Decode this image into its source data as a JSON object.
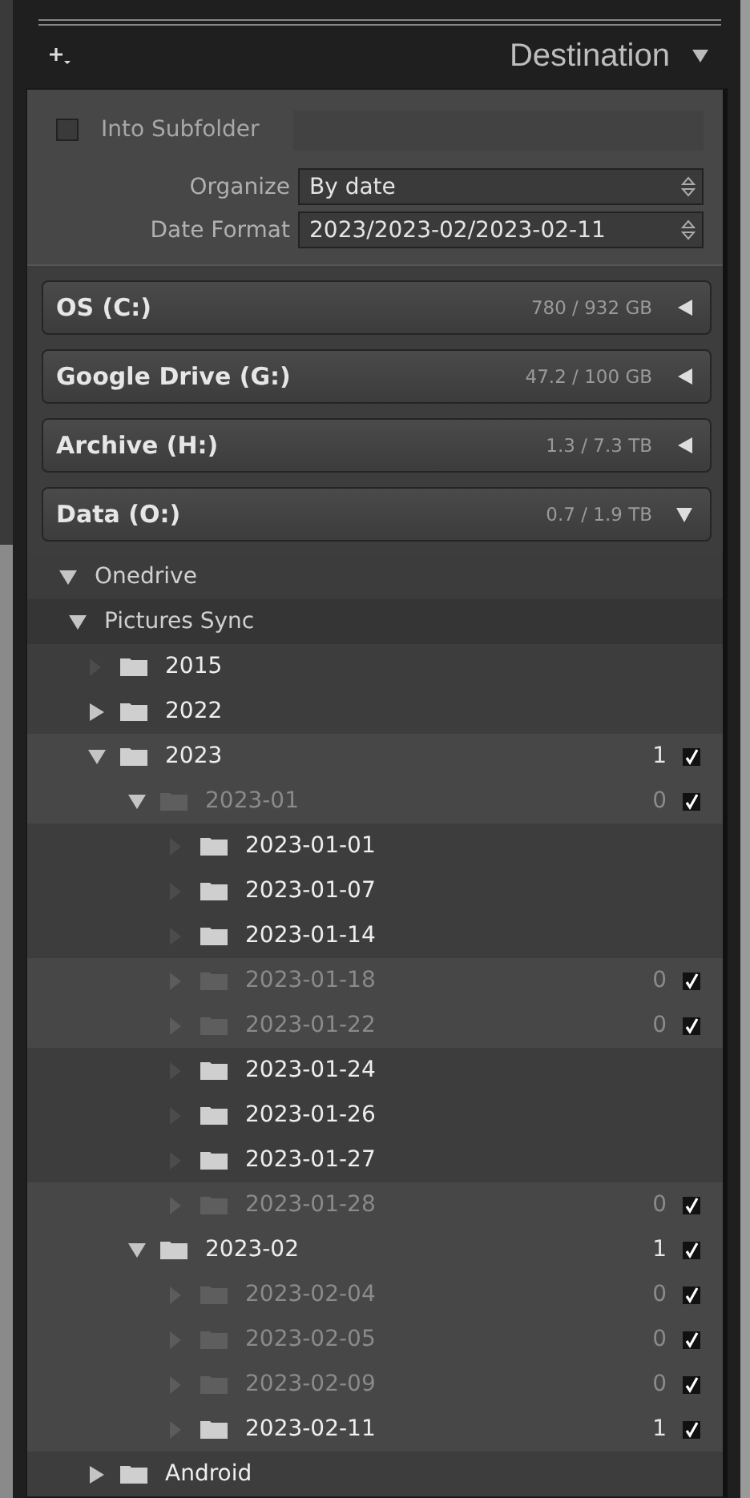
{
  "panel": {
    "title": "Destination",
    "expanded": true
  },
  "subfolder": {
    "label": "Into Subfolder",
    "checked": false
  },
  "organize": {
    "label": "Organize",
    "value": "By date"
  },
  "date_format": {
    "label": "Date Format",
    "value": "2023/2023-02/2023-02-11"
  },
  "drives": [
    {
      "name": "OS (C:)",
      "usage": "780 / 932 GB",
      "expanded": false
    },
    {
      "name": "Google Drive (G:)",
      "usage": "47.2 / 100 GB",
      "expanded": false
    },
    {
      "name": "Archive (H:)",
      "usage": "1.3 / 7.3 TB",
      "expanded": false
    },
    {
      "name": "Data (O:)",
      "usage": "0.7 / 1.9 TB",
      "expanded": true
    }
  ],
  "tree": [
    {
      "name": "Onedrive",
      "kind": "drive-folder",
      "expanded": true,
      "children": [
        {
          "name": "Pictures Sync",
          "kind": "sync-folder",
          "expanded": true,
          "children": [
            {
              "name": "2015",
              "kind": "folder",
              "selected": false,
              "dimmed": false
            },
            {
              "name": "2022",
              "kind": "folder",
              "expanded": false,
              "selected": false,
              "dimmed": false
            },
            {
              "name": "2023",
              "kind": "folder",
              "expanded": true,
              "selected": true,
              "dimmed": false,
              "count": "1",
              "checked": true,
              "children": [
                {
                  "name": "2023-01",
                  "kind": "folder",
                  "expanded": true,
                  "selected": true,
                  "dimmed": true,
                  "count": "0",
                  "checked": true,
                  "children": [
                    {
                      "name": "2023-01-01",
                      "kind": "folder",
                      "selected": false,
                      "dimmed": false
                    },
                    {
                      "name": "2023-01-07",
                      "kind": "folder",
                      "selected": false,
                      "dimmed": false
                    },
                    {
                      "name": "2023-01-14",
                      "kind": "folder",
                      "selected": false,
                      "dimmed": false
                    },
                    {
                      "name": "2023-01-18",
                      "kind": "folder",
                      "selected": true,
                      "dimmed": true,
                      "count": "0",
                      "checked": true
                    },
                    {
                      "name": "2023-01-22",
                      "kind": "folder",
                      "selected": true,
                      "dimmed": true,
                      "count": "0",
                      "checked": true
                    },
                    {
                      "name": "2023-01-24",
                      "kind": "folder",
                      "selected": false,
                      "dimmed": false
                    },
                    {
                      "name": "2023-01-26",
                      "kind": "folder",
                      "selected": false,
                      "dimmed": false
                    },
                    {
                      "name": "2023-01-27",
                      "kind": "folder",
                      "selected": false,
                      "dimmed": false
                    },
                    {
                      "name": "2023-01-28",
                      "kind": "folder",
                      "selected": true,
                      "dimmed": true,
                      "count": "0",
                      "checked": true
                    }
                  ]
                },
                {
                  "name": "2023-02",
                  "kind": "folder",
                  "expanded": true,
                  "selected": true,
                  "dimmed": false,
                  "count": "1",
                  "checked": true,
                  "children": [
                    {
                      "name": "2023-02-04",
                      "kind": "folder",
                      "selected": true,
                      "dimmed": true,
                      "count": "0",
                      "checked": true
                    },
                    {
                      "name": "2023-02-05",
                      "kind": "folder",
                      "selected": true,
                      "dimmed": true,
                      "count": "0",
                      "checked": true
                    },
                    {
                      "name": "2023-02-09",
                      "kind": "folder",
                      "selected": true,
                      "dimmed": true,
                      "count": "0",
                      "checked": true
                    },
                    {
                      "name": "2023-02-11",
                      "kind": "folder",
                      "selected": true,
                      "dimmed": false,
                      "count": "1",
                      "checked": true
                    }
                  ]
                }
              ]
            },
            {
              "name": "Android",
              "kind": "folder",
              "expanded": false,
              "selected": false,
              "dimmed": false
            }
          ]
        }
      ]
    }
  ]
}
